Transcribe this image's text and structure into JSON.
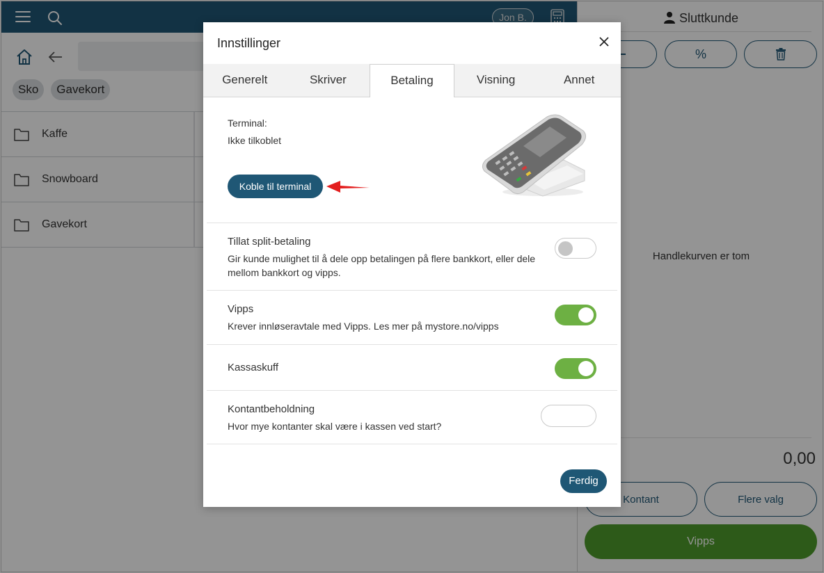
{
  "topbar": {
    "user_label": "Jon B."
  },
  "breadcrumb": {
    "chips": [
      "Sko",
      "Gavekort"
    ]
  },
  "folders": [
    "Kaffe",
    "Snowboard",
    "Gavekort"
  ],
  "cart": {
    "customer": "Sluttkunde",
    "percent_symbol": "%",
    "empty_text": "Handlekurven er tom",
    "total": "0,00",
    "cash_button": "Kontant",
    "more_button": "Flere valg",
    "vipps_button": "Vipps"
  },
  "modal": {
    "title": "Innstillinger",
    "tabs": [
      "Generelt",
      "Skriver",
      "Betaling",
      "Visning",
      "Annet"
    ],
    "active_tab": "Betaling",
    "terminal": {
      "label": "Terminal:",
      "status": "Ikke tilkoblet",
      "connect_button": "Koble til terminal"
    },
    "settings": [
      {
        "title": "Tillat split-betaling",
        "description": "Gir kunde mulighet til å dele opp betalingen på flere bankkort, eller dele mellom bankkort og vipps.",
        "enabled": false
      },
      {
        "title": "Vipps",
        "description": "Krever innløseravtale med Vipps. Les mer på mystore.no/vipps",
        "enabled": true
      },
      {
        "title": "Kassaskuff",
        "description": "",
        "enabled": true
      },
      {
        "title": "Kontantbeholdning",
        "description": "Hvor mye kontanter skal være i kassen ved start?",
        "value": ""
      }
    ],
    "done_button": "Ferdig"
  },
  "colors": {
    "primary": "#1f5775",
    "toggle_on": "#6db043",
    "vipps_green": "#4e9b2b",
    "annotation_arrow": "#e31e1e"
  }
}
